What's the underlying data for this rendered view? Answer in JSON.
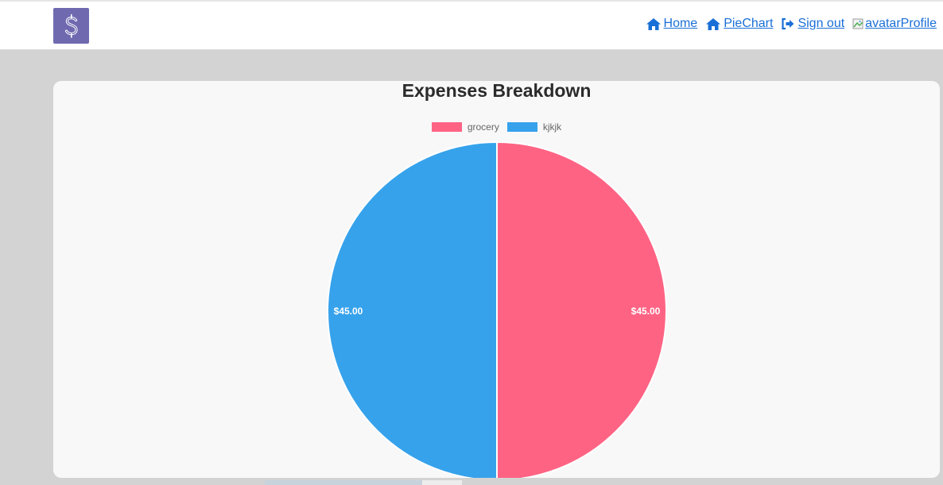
{
  "nav": {
    "links": [
      {
        "label": "Home",
        "icon": "home-icon"
      },
      {
        "label": "PieChart",
        "icon": "home-icon"
      },
      {
        "label": "Sign out",
        "icon": "sign-out-icon"
      }
    ],
    "avatar_alt": "avatar",
    "profile_label": "Profile"
  },
  "colors": {
    "brand": "#6f6ab0",
    "link": "#1a6fd6"
  },
  "chart_data": {
    "type": "pie",
    "title": "Expenses Breakdown",
    "categories": [
      "grocery",
      "kjkjk"
    ],
    "values": [
      45,
      45
    ],
    "data_labels": [
      "$45.00",
      "$45.00"
    ],
    "colors": [
      "#ff6384",
      "#36a2eb"
    ],
    "legend": "top"
  }
}
